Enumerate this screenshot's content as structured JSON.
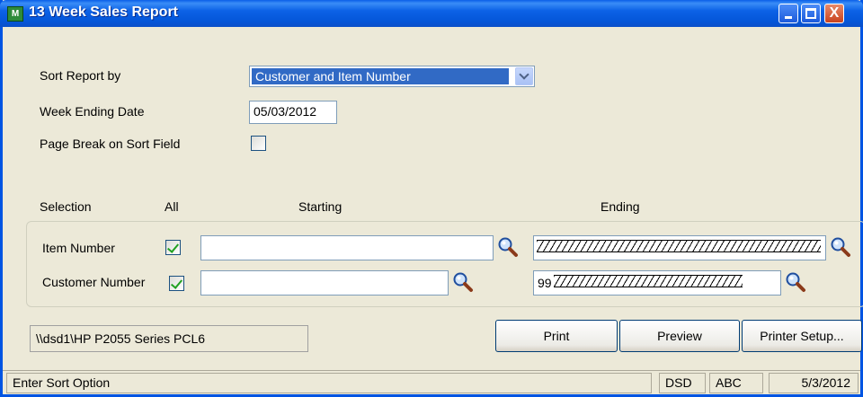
{
  "window": {
    "app_icon_text": "M",
    "title": "13 Week Sales Report",
    "close_glyph": "X"
  },
  "options": {
    "sort_label": "Sort Report by",
    "sort_value": "Customer and Item Number",
    "week_ending_label": "Week Ending Date",
    "week_ending_value": "05/03/2012",
    "page_break_label": "Page Break on Sort Field",
    "page_break_checked": false
  },
  "selection": {
    "headers": {
      "selection": "Selection",
      "all": "All",
      "starting": "Starting",
      "ending": "Ending"
    },
    "rows": [
      {
        "label": "Item Number",
        "all_checked": true,
        "starting": "",
        "ending": ""
      },
      {
        "label": "Customer Number",
        "all_checked": true,
        "starting": "",
        "ending_prefix": "99"
      }
    ]
  },
  "printer": {
    "name": "\\\\dsd1\\HP P2055 Series PCL6"
  },
  "buttons": {
    "print": "Print",
    "preview": "Preview",
    "printer_setup": "Printer Setup..."
  },
  "status": {
    "message": "Enter Sort Option",
    "company_code": "DSD",
    "company": "ABC",
    "date": "5/3/2012"
  }
}
